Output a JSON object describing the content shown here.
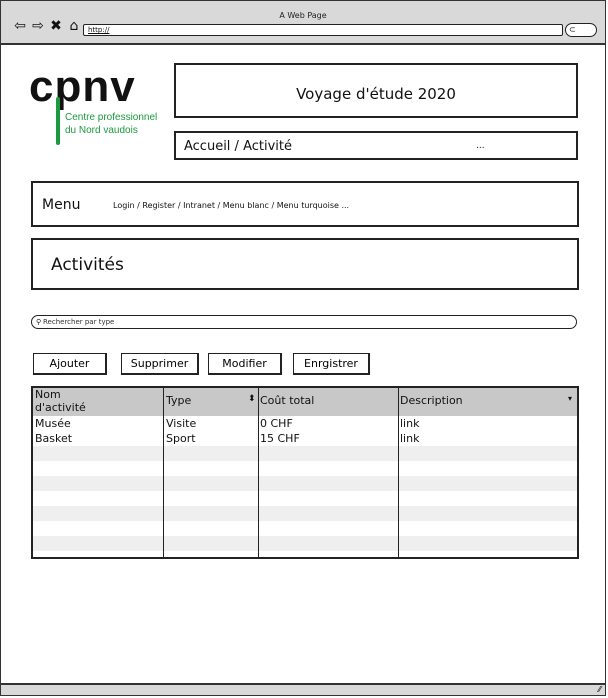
{
  "browser": {
    "window_title": "A Web Page",
    "url": "http://"
  },
  "logo": {
    "text": "cpnv",
    "sub_line1": "Centre professionnel",
    "sub_line2": "du Nord vaudois",
    "color": "#1a9a3e"
  },
  "header": {
    "title": "Voyage d'étude 2020",
    "breadcrumb": "Accueil  / Activité",
    "breadcrumb_ellipsis": "..."
  },
  "menu": {
    "label": "Menu",
    "links": "Login / Register / Intranet / Menu blanc / Menu turquoise   ..."
  },
  "section": {
    "heading": "Activités"
  },
  "search": {
    "placeholder": "Rechercher par type"
  },
  "toolbar": {
    "add": "Ajouter",
    "delete": "Supprimer",
    "edit": "Modifier",
    "save": "Enrgistrer"
  },
  "table": {
    "headers": {
      "name_line1": "Nom",
      "name_line2": "d'activité",
      "type": "Type",
      "cost": "Coût total",
      "description": "Description"
    },
    "rows": [
      {
        "name": "Musée",
        "type": "Visite",
        "cost": "0 CHF",
        "description": "link"
      },
      {
        "name": "Basket",
        "type": "Sport",
        "cost": "15 CHF",
        "description": "link"
      }
    ]
  }
}
